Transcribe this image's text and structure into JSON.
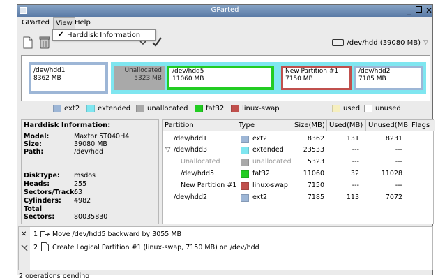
{
  "window": {
    "title": "GParted"
  },
  "menubar": {
    "gparted": "GParted",
    "view": "View",
    "help": "Help"
  },
  "view_menu": {
    "harddisk_info": "Harddisk Information",
    "harddisk_info_checked": true
  },
  "device_selector": {
    "label": "/dev/hdd (39080 MB)"
  },
  "graph": {
    "partitions": [
      {
        "name": "/dev/hdd1",
        "size": "8362 MB",
        "type": "ext2",
        "color": "#9db6d6"
      },
      {
        "name": "Unallocated",
        "size": "5323 MB",
        "type": "unallocated",
        "color": "#a9a9a9"
      },
      {
        "name": "/dev/hdd5",
        "size": "11060 MB",
        "type": "fat32",
        "color": "#22cc22"
      },
      {
        "name": "New Partition #1",
        "size": "7150 MB",
        "type": "linux-swap",
        "color": "#c0504d"
      },
      {
        "name": "/dev/hdd2",
        "size": "7185 MB",
        "type": "ext2",
        "color": "#9db6d6"
      }
    ],
    "extended_color": "#7fe6f0"
  },
  "legend": [
    {
      "label": "ext2",
      "color": "#9db6d6"
    },
    {
      "label": "extended",
      "color": "#7fe6f0"
    },
    {
      "label": "unallocated",
      "color": "#a9a9a9"
    },
    {
      "label": "fat32",
      "color": "#22cc22"
    },
    {
      "label": "linux-swap",
      "color": "#c0504d"
    },
    {
      "label": "used",
      "color": "#f6efbf"
    },
    {
      "label": "unused",
      "color": "#ffffff"
    }
  ],
  "disk_info": {
    "heading": "Harddisk Information:",
    "model_k": "Model:",
    "model_v": "Maxtor 5T040H4",
    "size_k": "Size:",
    "size_v": "39080 MB",
    "path_k": "Path:",
    "path_v": "/dev/hdd",
    "disktype_k": "DiskType:",
    "disktype_v": "msdos",
    "heads_k": "Heads:",
    "heads_v": "255",
    "sectors_k": "Sectors/Track:",
    "sectors_v": "63",
    "cylinders_k": "Cylinders:",
    "cylinders_v": "4982",
    "total_k": "Total Sectors:",
    "total_v": "80035830"
  },
  "table": {
    "headers": [
      "Partition",
      "Type",
      "Size(MB)",
      "Used(MB)",
      "Unused(MB)",
      "Flags"
    ],
    "rows": [
      {
        "partition": "/dev/hdd1",
        "type": "ext2",
        "color": "#9db6d6",
        "size": "8362",
        "used": "131",
        "unused": "8231",
        "flags": ""
      },
      {
        "partition": "/dev/hdd3",
        "type": "extended",
        "color": "#7fe6f0",
        "size": "23533",
        "used": "---",
        "unused": "---",
        "flags": ""
      },
      {
        "partition": "Unallocated",
        "type": "unallocated",
        "color": "#a9a9a9",
        "size": "5323",
        "used": "---",
        "unused": "---",
        "flags": ""
      },
      {
        "partition": "/dev/hdd5",
        "type": "fat32",
        "color": "#22cc22",
        "size": "11060",
        "used": "32",
        "unused": "11028",
        "flags": ""
      },
      {
        "partition": "New Partition #1",
        "type": "linux-swap",
        "color": "#c0504d",
        "size": "7150",
        "used": "---",
        "unused": "---",
        "flags": ""
      },
      {
        "partition": "/dev/hdd2",
        "type": "ext2",
        "color": "#9db6d6",
        "size": "7185",
        "used": "113",
        "unused": "7072",
        "flags": ""
      }
    ]
  },
  "operations": [
    {
      "num": "1",
      "text": "Move /dev/hdd5 backward by 3055 MB"
    },
    {
      "num": "2",
      "text": "Create Logical Partition #1 (linux-swap, 7150 MB) on /dev/hdd"
    }
  ],
  "status": {
    "text": "2 operations pending"
  }
}
